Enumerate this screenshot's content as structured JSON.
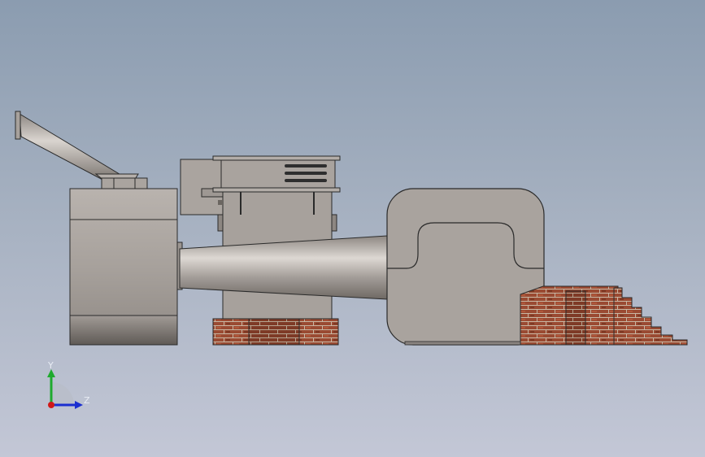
{
  "viewport": {
    "background_top": "#8b9cb0",
    "background_bottom": "#c3c7d6",
    "model_color": "#a8a29e",
    "model_edge_color": "#2a2a2a",
    "brick_color": "#9a4a32"
  },
  "triad": {
    "y_label": "Y",
    "z_label": "Z",
    "y_color": "#1faa2e",
    "z_color": "#1b2fd0",
    "x_color": "#d01818"
  }
}
